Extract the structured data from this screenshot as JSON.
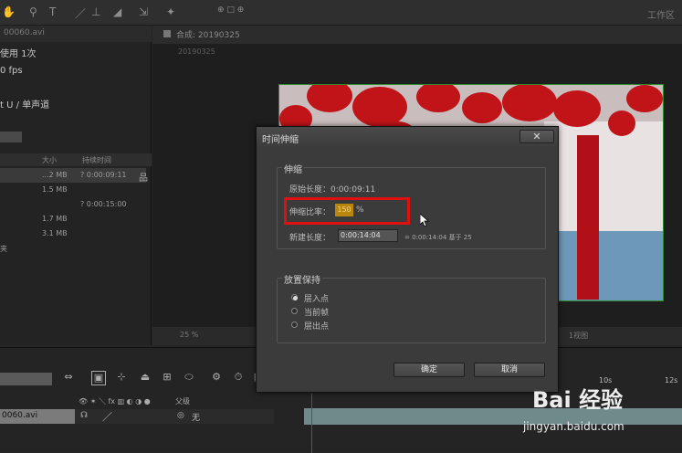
{
  "top_toolbar": {
    "workspace_label": "工作区"
  },
  "project_panel": {
    "tab_label": "00060.avi",
    "info": [
      "使用 1次",
      "0 fps",
      "t U / 单声道"
    ],
    "columns": [
      "大小",
      "持续时间"
    ],
    "rows": [
      {
        "size": "...2 MB",
        "duration": "? 0:00:09:11"
      },
      {
        "size": "1.5 MB",
        "duration": ""
      },
      {
        "size": "",
        "duration": "? 0:00:15:00"
      },
      {
        "size": "1.7 MB",
        "duration": ""
      },
      {
        "size": "3.1 MB",
        "duration": ""
      },
      {
        "size": "",
        "duration": ""
      }
    ],
    "last_row_label": "夹"
  },
  "composition_panel": {
    "tab_label": "合成: 20190325",
    "sub_label": "20190325",
    "zoom": "25 %",
    "view_label": "1视图"
  },
  "timeline": {
    "layer_name": "0060.avi",
    "mode_value": "无",
    "parent_label": "父级",
    "ruler_labels": [
      "10s",
      "12s"
    ]
  },
  "dialog": {
    "title": "时间伸缩",
    "close_label": "✕",
    "stretch_group": "伸缩",
    "original_label": "原始长度：0:00:09:11",
    "ratio_label": "伸缩比率：",
    "ratio_value": "150",
    "ratio_unit": "%",
    "new_length_label": "新建长度：",
    "new_length_value": "0:00:14:04",
    "new_length_note": "= 0:00:14:04  基于 25",
    "hold_group": "放置保持",
    "hold_options": [
      "层入点",
      "当前帧",
      "层出点"
    ],
    "hold_selected": 0,
    "ok_label": "确定",
    "cancel_label": "取消"
  },
  "watermark": {
    "brand": "Bai 经验",
    "url": "jingyan.baidu.com"
  }
}
